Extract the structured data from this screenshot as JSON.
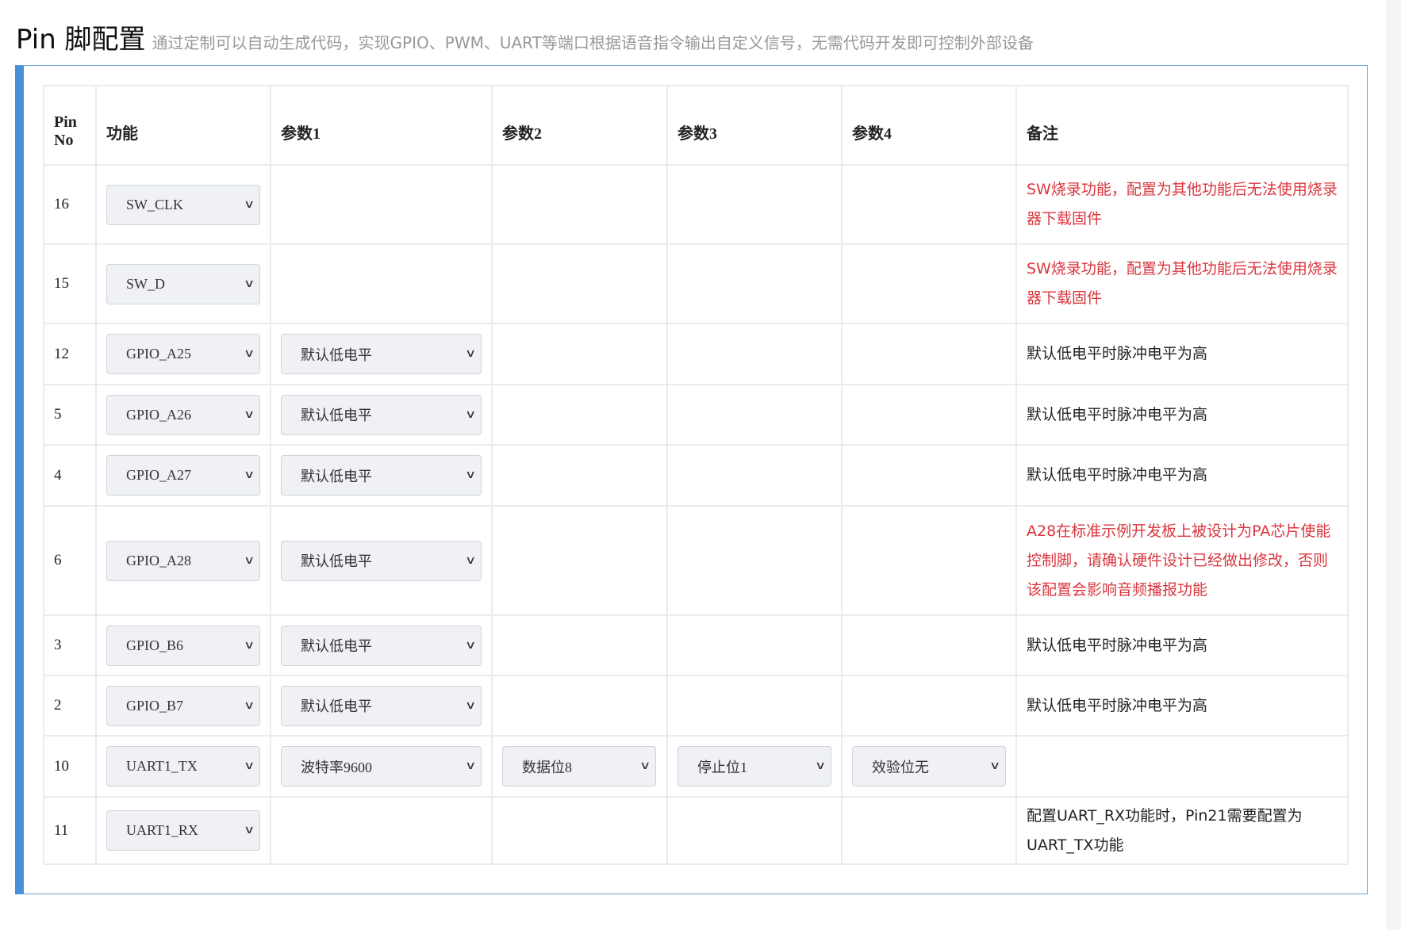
{
  "title": "Pin 脚配置",
  "subtitle": "通过定制可以自动生成代码，实现GPIO、PWM、UART等端口根据语音指令输出自定义信号，无需代码开发即可控制外部设备",
  "headers": [
    "Pin No",
    "功能",
    "参数1",
    "参数2",
    "参数3",
    "参数4",
    "备注"
  ],
  "colors": {
    "warning": "#d9363e",
    "accent": "#4a90d9"
  },
  "rows": [
    {
      "pin": "16",
      "func": "SW_CLK",
      "p1": null,
      "p2": null,
      "p3": null,
      "p4": null,
      "note": "SW烧录功能，配置为其他功能后无法使用烧录器下载固件",
      "warn": true,
      "h": 100
    },
    {
      "pin": "15",
      "func": "SW_D",
      "p1": null,
      "p2": null,
      "p3": null,
      "p4": null,
      "note": "SW烧录功能，配置为其他功能后无法使用烧录器下载固件",
      "warn": true,
      "h": 100
    },
    {
      "pin": "12",
      "func": "GPIO_A25",
      "p1": "默认低电平",
      "note": "默认低电平时脉冲电平为高",
      "h": 77
    },
    {
      "pin": "5",
      "func": "GPIO_A26",
      "p1": "默认低电平",
      "note": "默认低电平时脉冲电平为高",
      "h": 76
    },
    {
      "pin": "4",
      "func": "GPIO_A27",
      "p1": "默认低电平",
      "note": "默认低电平时脉冲电平为高",
      "h": 77
    },
    {
      "pin": "6",
      "func": "GPIO_A28",
      "p1": "默认低电平",
      "note": "A28在标准示例开发板上被设计为PA芯片使能控制脚，请确认硬件设计已经做出修改，否则该配置会影响音频播报功能",
      "warn": true,
      "h": 138
    },
    {
      "pin": "3",
      "func": "GPIO_B6",
      "p1": "默认低电平",
      "note": "默认低电平时脉冲电平为高",
      "h": 76
    },
    {
      "pin": "2",
      "func": "GPIO_B7",
      "p1": "默认低电平",
      "note": "默认低电平时脉冲电平为高",
      "h": 76
    },
    {
      "pin": "10",
      "func": "UART1_TX",
      "p1": "波特率9600",
      "p2": "数据位8",
      "p3": "停止位1",
      "p4": "效验位无",
      "note": "",
      "h": 77
    },
    {
      "pin": "11",
      "func": "UART1_RX",
      "p1": null,
      "note": "配置UART_RX功能时，Pin21需要配置为UART_TX功能",
      "h": 85
    }
  ]
}
